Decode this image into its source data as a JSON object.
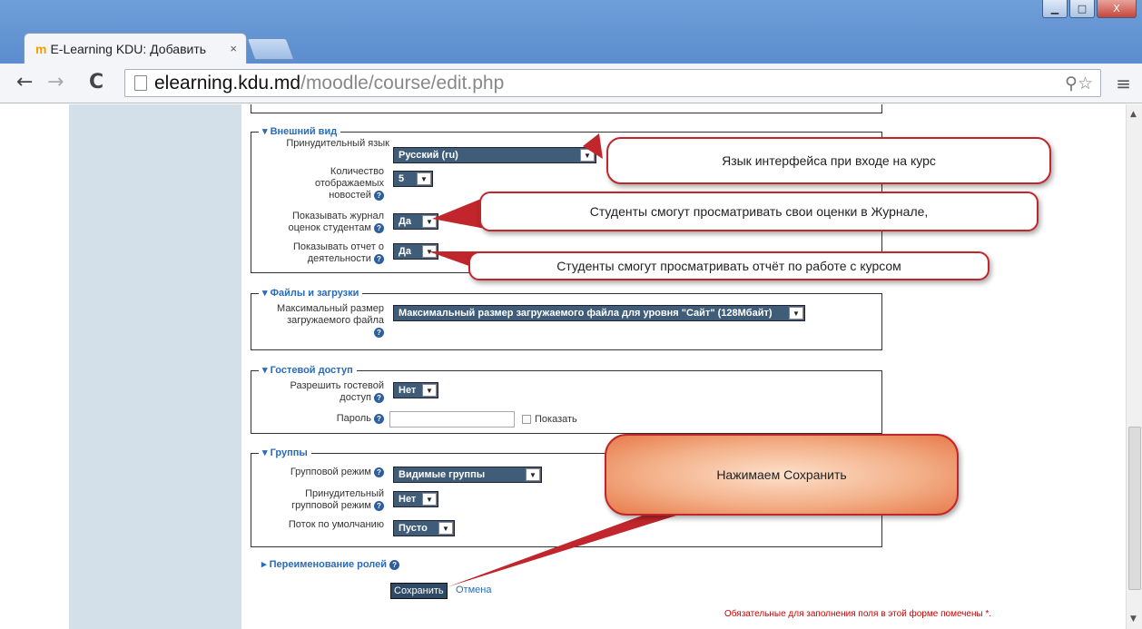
{
  "window": {
    "minimize": "▁",
    "maximize": "□",
    "close": "X"
  },
  "tab": {
    "title": "E-Learning KDU: Добавить",
    "close": "×",
    "favicon": "m"
  },
  "toolbar": {
    "back": "←",
    "forward": "→",
    "reload": "C",
    "url_host": "elearning.kdu.md",
    "url_path": "/moodle/course/edit.php",
    "url_icons": "⚲☆",
    "menu": "≡"
  },
  "appearance": {
    "legend": "▾ Внешний вид",
    "force_lang_label": "Принудительный язык",
    "force_lang_value": "Русский (ru)",
    "news_label": "Количество отображаемых новостей",
    "news_value": "5",
    "grades_label": "Показывать журнал оценок студентам",
    "grades_value": "Да",
    "report_label": "Показывать отчет о деятельности",
    "report_value": "Да"
  },
  "files": {
    "legend": "▾ Файлы и загрузки",
    "maxsize_label": "Максимальный размер загружаемого файла",
    "maxsize_value": "Максимальный размер загружаемого файла для уровня \"Сайт\" (128Мбайт)"
  },
  "guest": {
    "legend": "▾ Гостевой доступ",
    "allow_label": "Разрешить гостевой доступ",
    "allow_value": "Нет",
    "password_label": "Пароль",
    "show_label": "Показать"
  },
  "groups": {
    "legend": "▾ Группы",
    "mode_label": "Групповой режим",
    "mode_value": "Видимые группы",
    "force_label": "Принудительный групповой режим",
    "force_value": "Нет",
    "grouping_label": "Поток по умолчанию",
    "grouping_value": "Пусто"
  },
  "roles": {
    "label": "▸ Переименование ролей"
  },
  "actions": {
    "save": "Сохранить",
    "cancel": "Отмена",
    "required_note": "Обязательные для заполнения поля в этой форме помечены *."
  },
  "callouts": {
    "lang": "Язык интерфейса при входе на курс",
    "grades": "Студенты смогут просматривать свои оценки в Журнале,",
    "report": "Студенты смогут просматривать отчёт по работе с курсом",
    "save": "Нажимаем Сохранить"
  },
  "help_icon": "?",
  "dropdown_arrow": "▼"
}
